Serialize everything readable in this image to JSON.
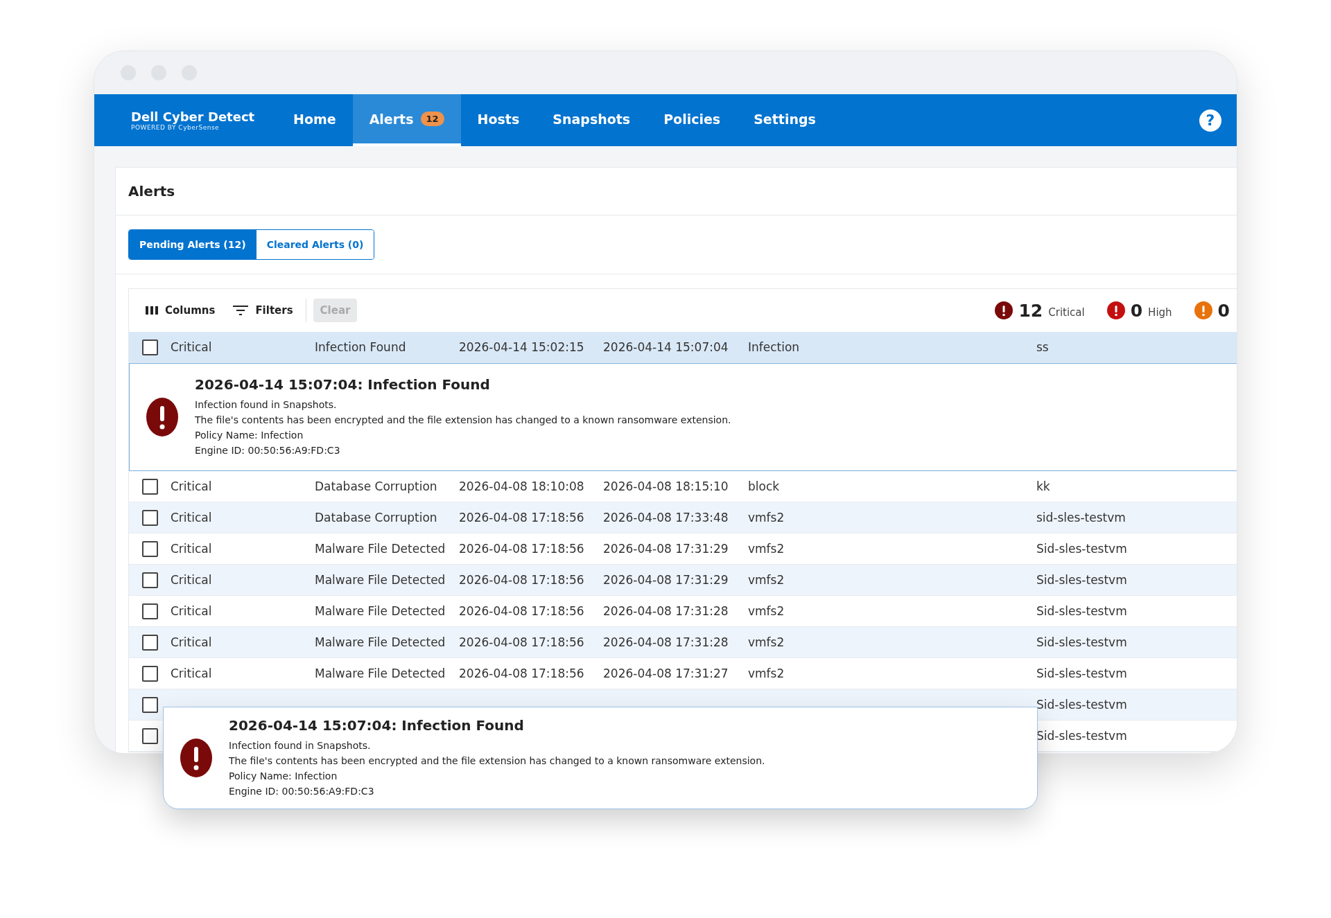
{
  "app": {
    "brand": "Dell Cyber Detect",
    "tagline": "POWERED BY CyberSense"
  },
  "nav": [
    {
      "label": "Home",
      "selected": false
    },
    {
      "label": "Alerts",
      "selected": true,
      "badge": "12"
    },
    {
      "label": "Hosts",
      "selected": false
    },
    {
      "label": "Snapshots",
      "selected": false
    },
    {
      "label": "Policies",
      "selected": false
    },
    {
      "label": "Settings",
      "selected": false
    }
  ],
  "help": "?",
  "page_title": "Alerts",
  "tabs": [
    {
      "label": "Pending Alerts (12)",
      "selected": true
    },
    {
      "label": "Cleared Alerts (0)",
      "selected": false
    }
  ],
  "toolbar": {
    "columns": "Columns",
    "filters": "Filters",
    "clear": {
      "label": "Clear",
      "disabled": true
    }
  },
  "severity_counts": [
    {
      "count": "12",
      "label": "Critical",
      "color": "#7a0a0a"
    },
    {
      "count": "0",
      "label": "High",
      "color": "#c40f0f"
    },
    {
      "count": "0",
      "color": "#e8720c"
    }
  ],
  "rows": [
    {
      "checked": false,
      "selected": true,
      "cells": [
        "Critical",
        "Infection Found",
        "2026-04-14 15:02:15",
        "2026-04-14 15:07:04",
        "Infection",
        "ss"
      ],
      "expanded": true,
      "detail": {
        "title": "2026-04-14 15:07:04: Infection Found",
        "lines": [
          "Infection found in Snapshots.",
          "The file's contents has been encrypted and the file extension has changed to a known ransomware extension.",
          "Policy Name: Infection",
          "Engine ID: 00:50:56:A9:FD:C3"
        ]
      }
    },
    {
      "checked": false,
      "selected": false,
      "cells": [
        "Critical",
        "Database Corruption",
        "2026-04-08 18:10:08",
        "2026-04-08 18:15:10",
        "block",
        "kk"
      ]
    },
    {
      "checked": false,
      "selected": false,
      "cells": [
        "Critical",
        "Database Corruption",
        "2026-04-08 17:18:56",
        "2026-04-08 17:33:48",
        "vmfs2",
        "sid-sles-testvm"
      ]
    },
    {
      "checked": false,
      "selected": false,
      "cells": [
        "Critical",
        "Malware File Detected",
        "2026-04-08 17:18:56",
        "2026-04-08 17:31:29",
        "vmfs2",
        "Sid-sles-testvm"
      ]
    },
    {
      "checked": false,
      "selected": false,
      "cells": [
        "Critical",
        "Malware File Detected",
        "2026-04-08 17:18:56",
        "2026-04-08 17:31:29",
        "vmfs2",
        "Sid-sles-testvm"
      ]
    },
    {
      "checked": false,
      "selected": false,
      "cells": [
        "Critical",
        "Malware File Detected",
        "2026-04-08 17:18:56",
        "2026-04-08 17:31:28",
        "vmfs2",
        "Sid-sles-testvm"
      ]
    },
    {
      "checked": false,
      "selected": false,
      "cells": [
        "Critical",
        "Malware File Detected",
        "2026-04-08 17:18:56",
        "2026-04-08 17:31:28",
        "vmfs2",
        "Sid-sles-testvm"
      ]
    },
    {
      "checked": false,
      "selected": false,
      "cells": [
        "Critical",
        "Malware File Detected",
        "2026-04-08 17:18:56",
        "2026-04-08 17:31:27",
        "vmfs2",
        "Sid-sles-testvm"
      ]
    },
    {
      "checked": false,
      "selected": false,
      "cells": [
        null,
        null,
        null,
        null,
        null,
        "Sid-sles-testvm"
      ]
    },
    {
      "checked": false,
      "selected": false,
      "cells": [
        null,
        null,
        null,
        null,
        null,
        "Sid-sles-testvm"
      ]
    }
  ],
  "popup": {
    "title": "2026-04-14 15:07:04: Infection Found",
    "lines": [
      "Infection found in Snapshots.",
      "The file's contents has been encrypted and the file extension has changed to a known ransomware extension.",
      "Policy Name: Infection",
      "Engine ID: 00:50:56:A9:FD:C3"
    ]
  }
}
